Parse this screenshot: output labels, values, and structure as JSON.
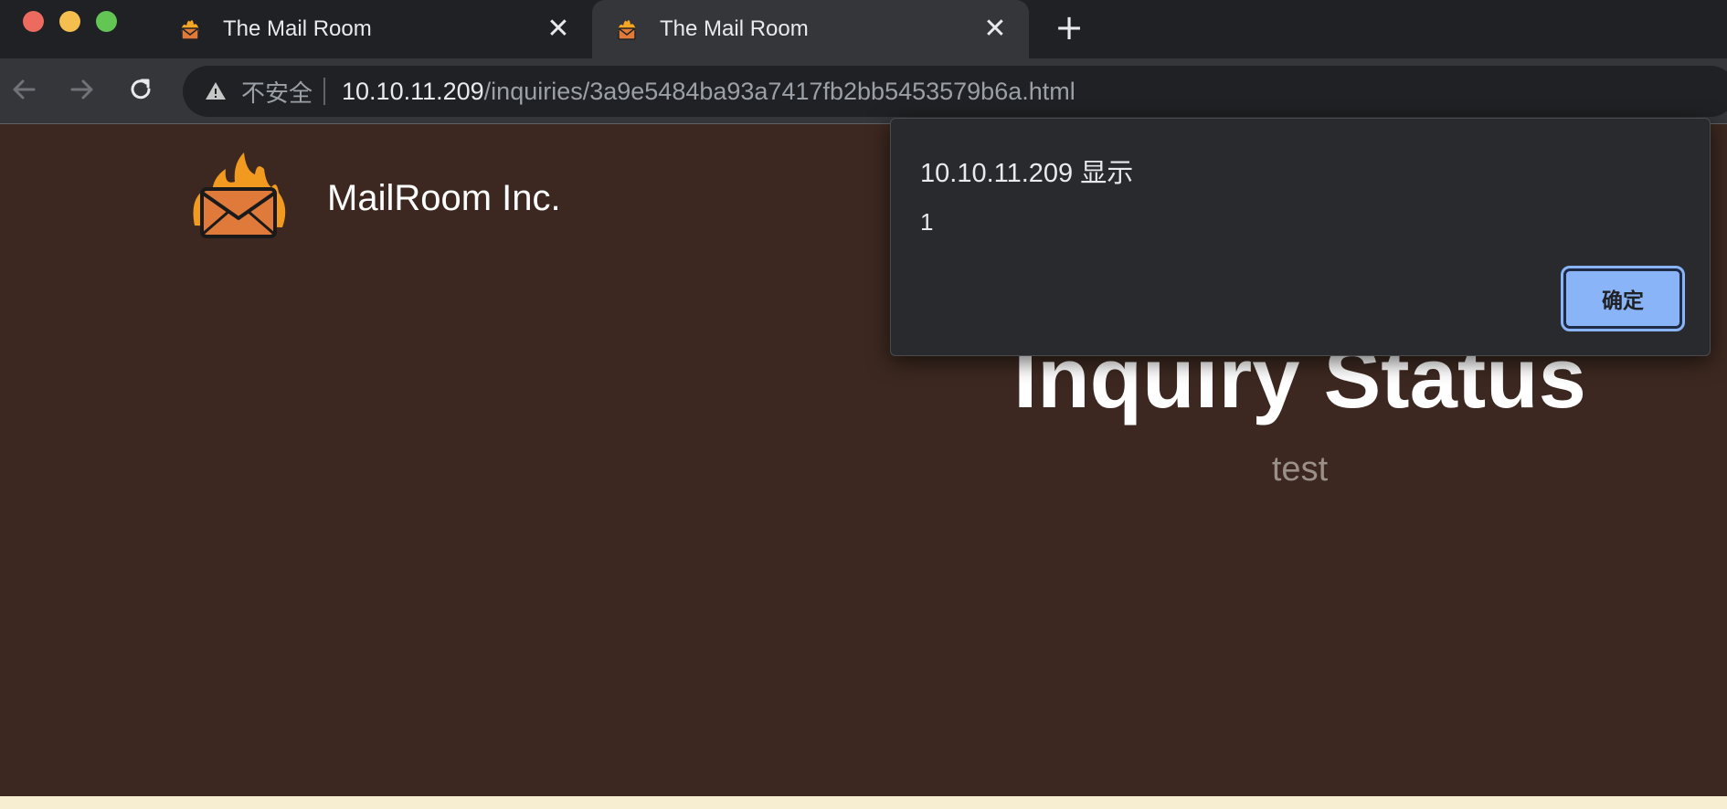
{
  "browser": {
    "tabs": [
      {
        "title": "The Mail Room",
        "favicon": "flaming-mail-icon",
        "active": false
      },
      {
        "title": "The Mail Room",
        "favicon": "flaming-mail-icon",
        "active": true
      }
    ],
    "new_tab_label": "+",
    "close_label": "✕",
    "omnibox": {
      "security_label": "不安全",
      "url_host": "10.10.11.209",
      "url_path": "/inquiries/3a9e5484ba93a7417fb2bb5453579b6a.html"
    }
  },
  "page": {
    "brand": "MailRoom Inc.",
    "heading": "Inquiry Status",
    "subtext": "test"
  },
  "dialog": {
    "title": "10.10.11.209 显示",
    "message": "1",
    "ok_label": "确定"
  },
  "colors": {
    "page_background": "#3c2820",
    "tab_strip": "#202124",
    "toolbar": "#35363a",
    "dialog_background": "#292a2d",
    "dialog_button": "#8ab4f8",
    "footer_strip": "#f7edd0"
  }
}
